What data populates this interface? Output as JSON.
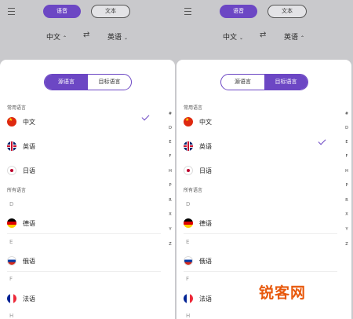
{
  "top": {
    "voice_tab": "语音",
    "text_tab": "文本",
    "source_lang": "中文",
    "target_lang": "英语",
    "swap_icon": "⇄"
  },
  "segment": {
    "source": "源语言",
    "target": "目标语言"
  },
  "common_header": "常用语言",
  "common": [
    {
      "label": "中文",
      "flag": "cn"
    },
    {
      "label": "英语",
      "flag": "uk"
    },
    {
      "label": "日语",
      "flag": "jp"
    }
  ],
  "all_header": "所有语言",
  "groups": [
    {
      "letter": "D",
      "label": "德语",
      "flag": "de"
    },
    {
      "letter": "E",
      "label": "俄语",
      "flag": "ru"
    },
    {
      "letter": "F",
      "label": "法语",
      "flag": "fr"
    },
    {
      "letter": "H"
    }
  ],
  "index": [
    "#",
    "D",
    "E",
    "F",
    "H",
    "P",
    "R",
    "X",
    "Y",
    "Z"
  ],
  "left_selected": "中文",
  "right_selected": "英语",
  "watermark": "锐客网"
}
